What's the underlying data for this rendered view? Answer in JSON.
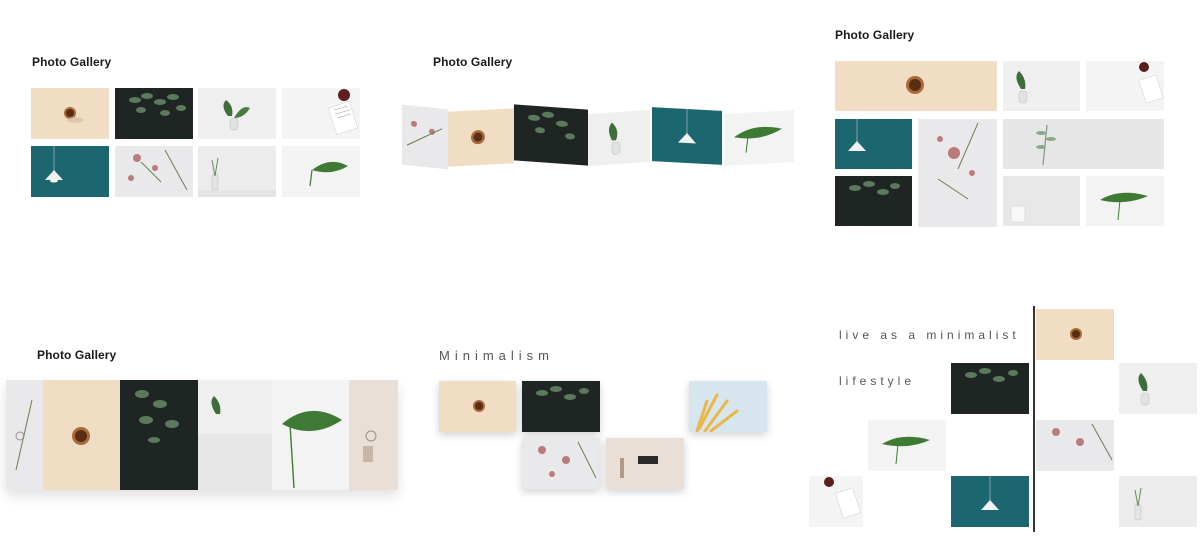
{
  "panels": {
    "p1": {
      "title": "Photo Gallery"
    },
    "p2": {
      "title": "Photo Gallery"
    },
    "p3": {
      "title": "Photo Gallery"
    },
    "p4": {
      "title": "Photo Gallery"
    },
    "p5": {
      "title": "Minimalism"
    },
    "p6": {
      "line1": "live as a minimalist",
      "line2": "lifestyle"
    }
  },
  "photos": {
    "coffee": "coffee-cup-photo",
    "fern": "fern-leaves-photo",
    "vase": "plant-vase-photo",
    "paper": "paper-berries-photo",
    "lamp": "pendant-lamp-photo",
    "flowers": "dried-flowers-photo",
    "bottle": "glass-bottle-photo",
    "leaf": "single-leaf-photo",
    "yellow": "yellow-grass-photo",
    "room": "room-shelf-photo"
  },
  "colors": {
    "beige": "#f1dcc4",
    "dark": "#1e2523",
    "teal": "#1c6670",
    "light": "#efefef"
  }
}
